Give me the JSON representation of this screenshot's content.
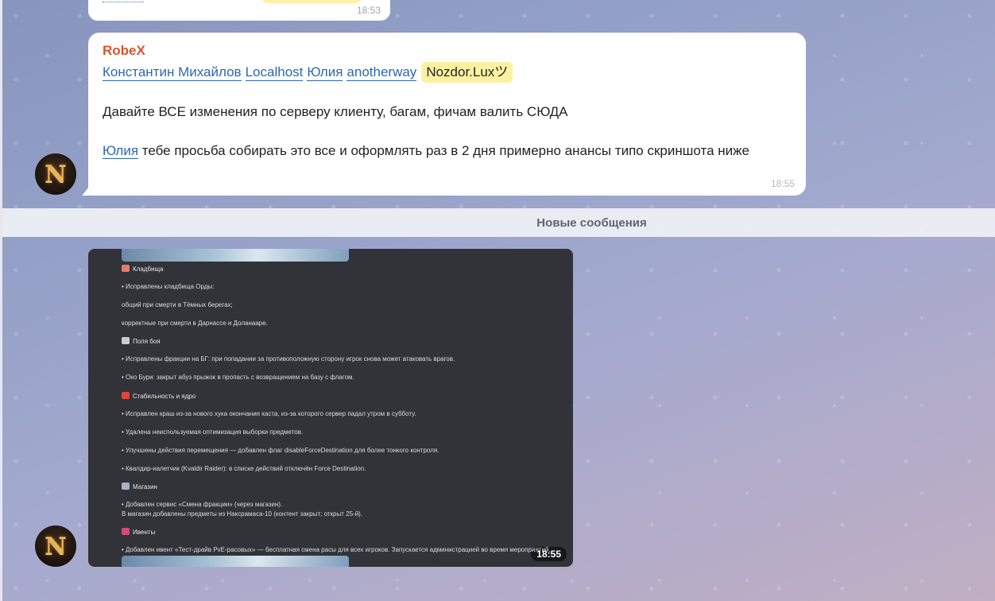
{
  "top_message": {
    "time": "18:53"
  },
  "message": {
    "sender": "RobeX",
    "mentions": [
      "Константин Михайлов",
      "Localhost",
      "Юлия",
      "anotherway"
    ],
    "highlight_mention": "Nozdor.Luxツ",
    "para1": "Давайте ВСЕ изменения по серверу клиенту, багам, фичам валить СЮДА",
    "para2_mention": "Юлия",
    "para2_text": " тебе просьба собирать это все и оформлять раз в 2 дня примерно анансы типо скриншота ниже",
    "time": "18:55"
  },
  "new_messages_label": "Новые сообщения",
  "screenshot": {
    "time": "18:55",
    "lines": [
      {
        "text": "Кладбища",
        "header": true,
        "emoji_color": "#e77a6c"
      },
      {
        "text": "• Исправлены кладбища Орды:"
      },
      {
        "text": "общий при смерти в Тёмных берегах;"
      },
      {
        "text": "корректные при смерти в Дарнассе и Доланааре."
      },
      {
        "text": "Поля боя",
        "header": true,
        "emoji_color": "#c9ccd3"
      },
      {
        "text": "• Исправлены фракции на БГ: при попадании за противоположную сторону игрок снова может атаковать врагов."
      },
      {
        "text": "• Око Бури: закрыт абуз    прыжок в пропасть с возвращением на базу с флагом."
      },
      {
        "text": "Стабильность и ядро",
        "header": true,
        "emoji_color": "#e0443a"
      },
      {
        "text": "• Исправлен краш из-за нового хука окончания каста, из-за которого сервер падал утром в субботу."
      },
      {
        "text": "• Удалена неиспользуемая оптимизация выборки предметов."
      },
      {
        "text": "• Улучшены действия перемещения — добавлен флаг disableForceDestination для более тонкого контроля."
      },
      {
        "text": "• Квалдир-налетчик (Kvaldir Raider): в списке действий отключён Force Destination."
      },
      {
        "text": "Магазин",
        "header": true,
        "emoji_color": "#a8b2c4"
      },
      {
        "text": "• Добавлен сервис «Смена фракции» (через магазин)."
      },
      {
        "text": "В магазин добавлены предметы из Наксрамаса-10 (контент закрыт; открыт 25-й)."
      },
      {
        "text": "Ивенты",
        "header": true,
        "emoji_color": "#d04a7a"
      },
      {
        "text": "• Добавлен ивент «Тест-драйв PvE-расовых» — бесплатная смена расы для всех игроков. Запускается администрацией во время мероприятий."
      }
    ]
  }
}
